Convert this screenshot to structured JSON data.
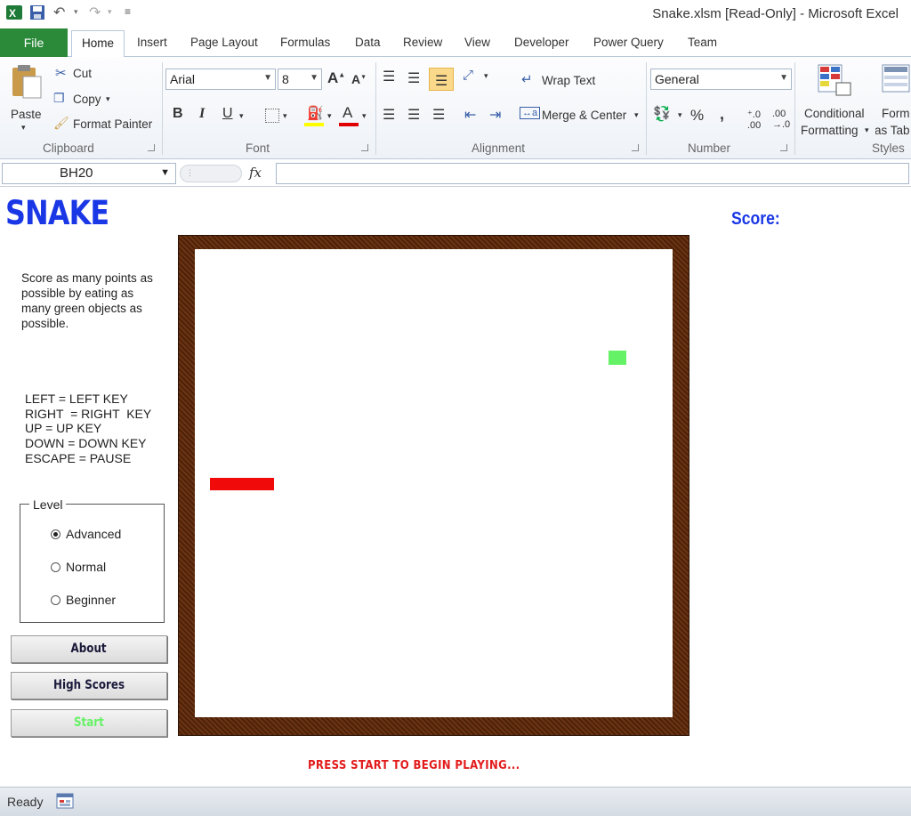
{
  "window": {
    "title": "Snake.xlsm  [Read-Only] - Microsoft Excel"
  },
  "tabs": {
    "file": "File",
    "items": [
      "Home",
      "Insert",
      "Page Layout",
      "Formulas",
      "Data",
      "Review",
      "View",
      "Developer",
      "Power Query",
      "Team"
    ]
  },
  "ribbon": {
    "clipboard": {
      "paste": "Paste",
      "cut": "Cut",
      "copy": "Copy",
      "format_painter": "Format Painter",
      "label": "Clipboard"
    },
    "font": {
      "name": "Arial",
      "size": "8",
      "label": "Font",
      "bold": "B",
      "italic": "I",
      "underline": "U"
    },
    "alignment": {
      "wrap_text": "Wrap Text",
      "merge_center": "Merge & Center",
      "label": "Alignment"
    },
    "number": {
      "format": "General",
      "percent": "%",
      "comma": ",",
      "label": "Number"
    },
    "styles": {
      "conditional_1": "Conditional",
      "conditional_2": "Formatting",
      "format_1": "Form",
      "format_2": "as Tab",
      "label": "Styles"
    }
  },
  "formula_bar": {
    "name_box": "BH20",
    "fx": "fx",
    "value": ""
  },
  "game": {
    "title": "SNAKE",
    "score_label": "Score:",
    "instructions": "Score as many points as possible by eating as many green objects as possible.",
    "controls": [
      "LEFT = LEFT KEY",
      "RIGHT  = RIGHT  KEY",
      "UP = UP KEY",
      "DOWN = DOWN KEY",
      "ESCAPE = PAUSE"
    ],
    "level": {
      "legend": "Level",
      "options": [
        {
          "label": "Advanced",
          "selected": true
        },
        {
          "label": "Normal",
          "selected": false
        },
        {
          "label": "Beginner",
          "selected": false
        }
      ]
    },
    "buttons": {
      "about": "About",
      "high_scores": "High Scores",
      "start": "Start"
    },
    "message": "PRESS START TO BEGIN PLAYING...",
    "colors": {
      "title": "#1a37e6",
      "food": "#66f266",
      "snake": "#f00a0a",
      "start_text": "#66f266",
      "message": "#e21b1b",
      "board_frame": "#6b3414"
    }
  },
  "status": {
    "ready": "Ready"
  }
}
